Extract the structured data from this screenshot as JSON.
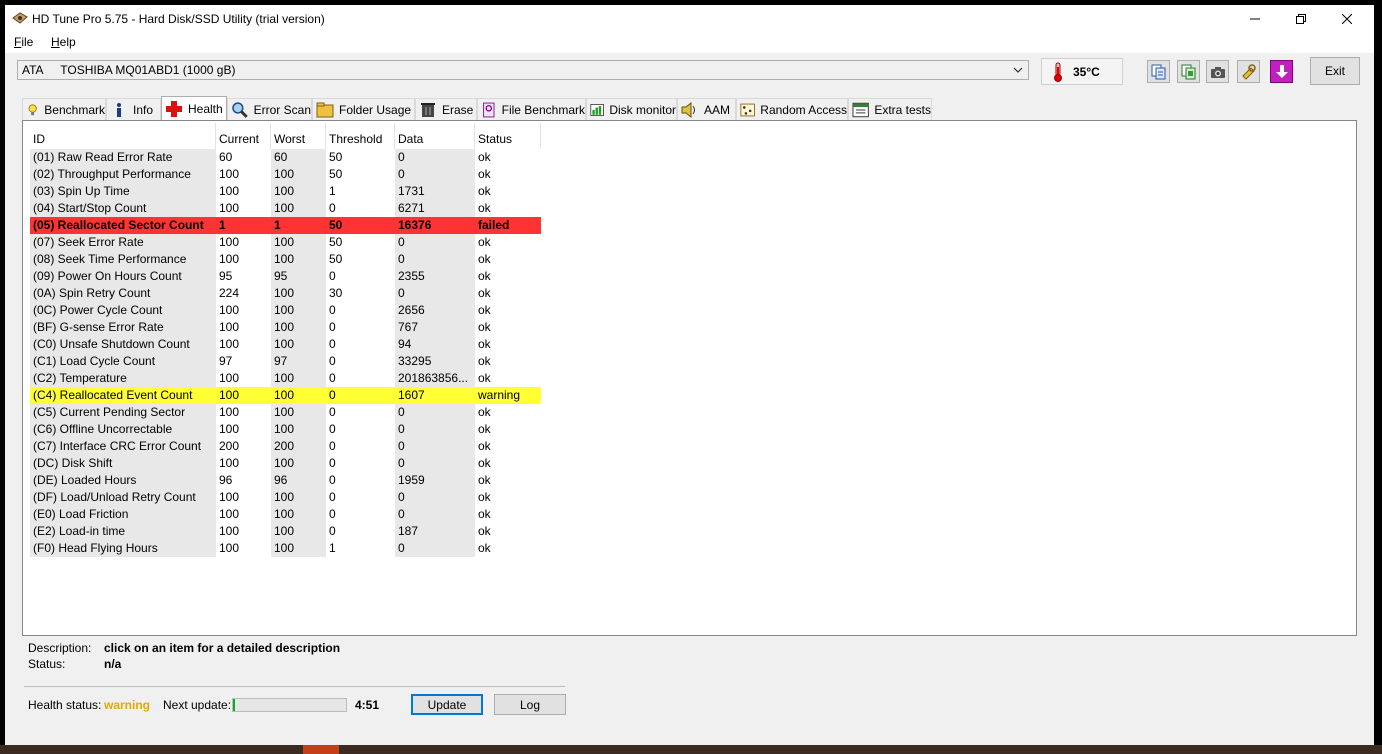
{
  "window": {
    "title": "HD Tune Pro 5.75 - Hard Disk/SSD Utility (trial version)"
  },
  "menu": [
    {
      "hotkey": "F",
      "rest": "ile"
    },
    {
      "hotkey": "H",
      "rest": "elp"
    }
  ],
  "drive": {
    "interface": "ATA",
    "name": "TOSHIBA MQ01ABD1 (1000 gB)"
  },
  "temperature": "35°C",
  "toolbar": {
    "exit_label": "Exit"
  },
  "tabs": [
    "Benchmark",
    "Info",
    "Health",
    "Error Scan",
    "Folder Usage",
    "Erase",
    "File Benchmark",
    "Disk monitor",
    "AAM",
    "Random Access",
    "Extra tests"
  ],
  "active_tab": "Health",
  "table": {
    "headers": [
      "ID",
      "Current",
      "Worst",
      "Threshold",
      "Data",
      "Status"
    ],
    "rows": [
      {
        "id": "(01) Raw Read Error Rate",
        "current": "60",
        "worst": "60",
        "threshold": "50",
        "data": "0",
        "status": "ok",
        "level": "ok"
      },
      {
        "id": "(02) Throughput Performance",
        "current": "100",
        "worst": "100",
        "threshold": "50",
        "data": "0",
        "status": "ok",
        "level": "ok"
      },
      {
        "id": "(03) Spin Up Time",
        "current": "100",
        "worst": "100",
        "threshold": "1",
        "data": "1731",
        "status": "ok",
        "level": "ok"
      },
      {
        "id": "(04) Start/Stop Count",
        "current": "100",
        "worst": "100",
        "threshold": "0",
        "data": "6271",
        "status": "ok",
        "level": "ok"
      },
      {
        "id": "(05) Reallocated Sector Count",
        "current": "1",
        "worst": "1",
        "threshold": "50",
        "data": "16376",
        "status": "failed",
        "level": "failed"
      },
      {
        "id": "(07) Seek Error Rate",
        "current": "100",
        "worst": "100",
        "threshold": "50",
        "data": "0",
        "status": "ok",
        "level": "ok"
      },
      {
        "id": "(08) Seek Time Performance",
        "current": "100",
        "worst": "100",
        "threshold": "50",
        "data": "0",
        "status": "ok",
        "level": "ok"
      },
      {
        "id": "(09) Power On Hours Count",
        "current": "95",
        "worst": "95",
        "threshold": "0",
        "data": "2355",
        "status": "ok",
        "level": "ok"
      },
      {
        "id": "(0A) Spin Retry Count",
        "current": "224",
        "worst": "100",
        "threshold": "30",
        "data": "0",
        "status": "ok",
        "level": "ok"
      },
      {
        "id": "(0C) Power Cycle Count",
        "current": "100",
        "worst": "100",
        "threshold": "0",
        "data": "2656",
        "status": "ok",
        "level": "ok"
      },
      {
        "id": "(BF) G-sense Error Rate",
        "current": "100",
        "worst": "100",
        "threshold": "0",
        "data": "767",
        "status": "ok",
        "level": "ok"
      },
      {
        "id": "(C0) Unsafe Shutdown Count",
        "current": "100",
        "worst": "100",
        "threshold": "0",
        "data": "94",
        "status": "ok",
        "level": "ok"
      },
      {
        "id": "(C1) Load Cycle Count",
        "current": "97",
        "worst": "97",
        "threshold": "0",
        "data": "33295",
        "status": "ok",
        "level": "ok"
      },
      {
        "id": "(C2) Temperature",
        "current": "100",
        "worst": "100",
        "threshold": "0",
        "data": "201863856...",
        "status": "ok",
        "level": "ok"
      },
      {
        "id": "(C4) Reallocated Event Count",
        "current": "100",
        "worst": "100",
        "threshold": "0",
        "data": "1607",
        "status": "warning",
        "level": "warning"
      },
      {
        "id": "(C5) Current Pending Sector",
        "current": "100",
        "worst": "100",
        "threshold": "0",
        "data": "0",
        "status": "ok",
        "level": "ok"
      },
      {
        "id": "(C6) Offline Uncorrectable",
        "current": "100",
        "worst": "100",
        "threshold": "0",
        "data": "0",
        "status": "ok",
        "level": "ok"
      },
      {
        "id": "(C7) Interface CRC Error Count",
        "current": "200",
        "worst": "200",
        "threshold": "0",
        "data": "0",
        "status": "ok",
        "level": "ok"
      },
      {
        "id": "(DC) Disk Shift",
        "current": "100",
        "worst": "100",
        "threshold": "0",
        "data": "0",
        "status": "ok",
        "level": "ok"
      },
      {
        "id": "(DE) Loaded Hours",
        "current": "96",
        "worst": "96",
        "threshold": "0",
        "data": "1959",
        "status": "ok",
        "level": "ok"
      },
      {
        "id": "(DF) Load/Unload Retry Count",
        "current": "100",
        "worst": "100",
        "threshold": "0",
        "data": "0",
        "status": "ok",
        "level": "ok"
      },
      {
        "id": "(E0) Load Friction",
        "current": "100",
        "worst": "100",
        "threshold": "0",
        "data": "0",
        "status": "ok",
        "level": "ok"
      },
      {
        "id": "(E2) Load-in time",
        "current": "100",
        "worst": "100",
        "threshold": "0",
        "data": "187",
        "status": "ok",
        "level": "ok"
      },
      {
        "id": "(F0) Head Flying Hours",
        "current": "100",
        "worst": "100",
        "threshold": "1",
        "data": "0",
        "status": "ok",
        "level": "ok"
      }
    ]
  },
  "details": {
    "description_label": "Description:",
    "description_value": "click on an item for a detailed description",
    "status_label": "Status:",
    "status_value": "n/a"
  },
  "footer": {
    "health_label": "Health status:",
    "health_value": "warning",
    "next_update_label": "Next update:",
    "next_update_progress": 0.02,
    "countdown": "4:51",
    "update_button": "Update",
    "log_button": "Log"
  },
  "colors": {
    "failed": "#ff3333",
    "warning": "#ffff33",
    "health_warning": "#e6a800",
    "progress": "#06b025"
  }
}
